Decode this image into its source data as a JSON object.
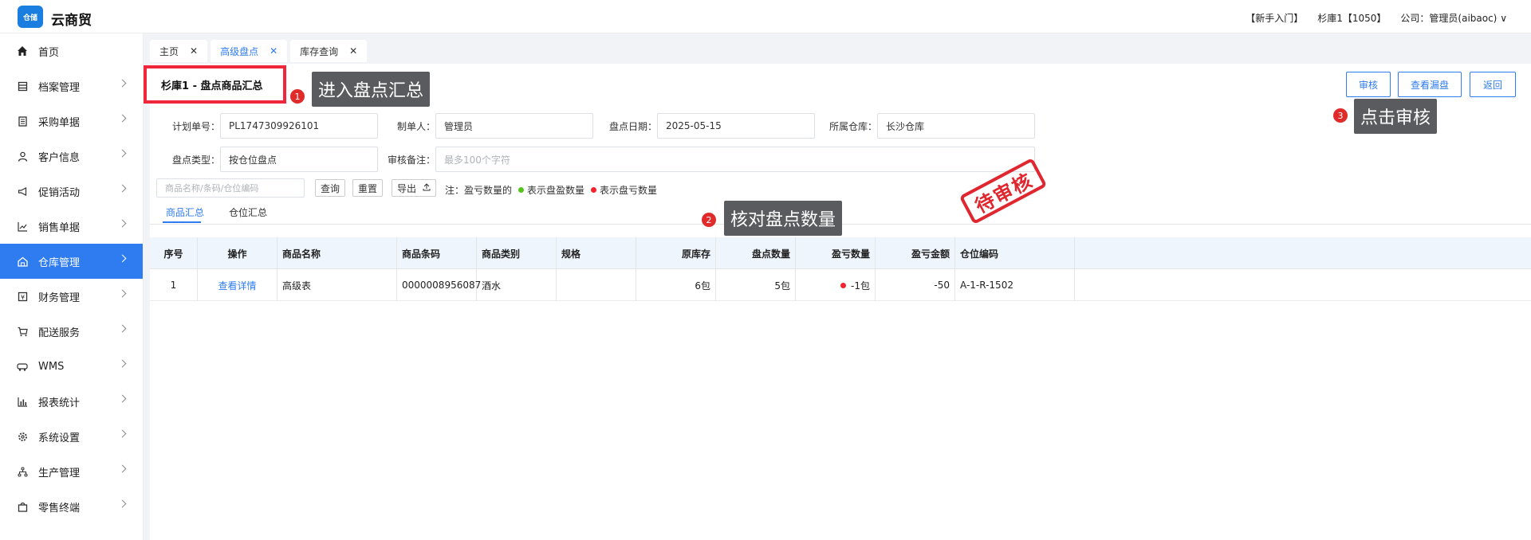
{
  "app": {
    "name": "云商贸",
    "logo_text": "仓储"
  },
  "topbar": {
    "guide": "【新手入门】",
    "store": "杉庫1【1050】",
    "company": "公司：管理员(aibaoc)"
  },
  "sidebar": {
    "items": [
      {
        "label": "首页",
        "icon": "home-icon"
      },
      {
        "label": "档案管理",
        "icon": "archive-icon"
      },
      {
        "label": "采购单据",
        "icon": "document-icon"
      },
      {
        "label": "客户信息",
        "icon": "user-icon"
      },
      {
        "label": "促销活动",
        "icon": "megaphone-icon"
      },
      {
        "label": "销售单据",
        "icon": "chart-line-icon"
      },
      {
        "label": "仓库管理",
        "icon": "warehouse-icon",
        "active": true
      },
      {
        "label": "财务管理",
        "icon": "finance-icon"
      },
      {
        "label": "配送服务",
        "icon": "cart-icon"
      },
      {
        "label": "WMS",
        "icon": "truck-icon"
      },
      {
        "label": "报表统计",
        "icon": "bar-chart-icon"
      },
      {
        "label": "系统设置",
        "icon": "gear-icon"
      },
      {
        "label": "生产管理",
        "icon": "flow-icon"
      },
      {
        "label": "零售终端",
        "icon": "bag-icon"
      }
    ]
  },
  "tabs": [
    {
      "label": "主页"
    },
    {
      "label": "高级盘点",
      "active": true
    },
    {
      "label": "库存查询"
    }
  ],
  "page": {
    "title": "杉庫1 - 盘点商品汇总"
  },
  "annotations": {
    "step1": {
      "num": "1",
      "text": "进入盘点汇总"
    },
    "step2": {
      "num": "2",
      "text": "核对盘点数量"
    },
    "step3": {
      "num": "3",
      "text": "点击审核"
    }
  },
  "actions": {
    "audit": "审核",
    "view_missing": "查看漏盘",
    "back": "返回"
  },
  "form": {
    "plan_no_label": "计划单号：",
    "plan_no": "PL1747309926101",
    "creator_label": "制单人：",
    "creator": "管理员",
    "date_label": "盘点日期：",
    "date": "2025-05-15",
    "warehouse_label": "所属仓库：",
    "warehouse": "长沙仓库",
    "type_label": "盘点类型：",
    "type": "按仓位盘点",
    "remark_label": "审核备注：",
    "remark_placeholder": "最多100个字符",
    "search_placeholder": "商品名称/条码/仓位编码"
  },
  "stamp": "待审核",
  "search_buttons": {
    "query": "查询",
    "reset": "重置",
    "export": "导出"
  },
  "legend": {
    "note": "注：盈亏数量的",
    "surplus": "表示盘盈数量",
    "loss": "表示盘亏数量",
    "surplus_color": "#52c41a",
    "loss_color": "#f5222d"
  },
  "subtabs": [
    {
      "label": "商品汇总",
      "active": true
    },
    {
      "label": "仓位汇总"
    }
  ],
  "table": {
    "headers": [
      "序号",
      "操作",
      "商品名称",
      "商品条码",
      "商品类别",
      "规格",
      "原库存",
      "盘点数量",
      "盈亏数量",
      "盈亏金额",
      "仓位编码"
    ],
    "rows": [
      [
        "1",
        "查看详情",
        "高级表",
        "0000008956087",
        "酒水",
        "",
        "6包",
        "5包",
        "-1包",
        "-50",
        "A-1-R-1502"
      ]
    ]
  }
}
